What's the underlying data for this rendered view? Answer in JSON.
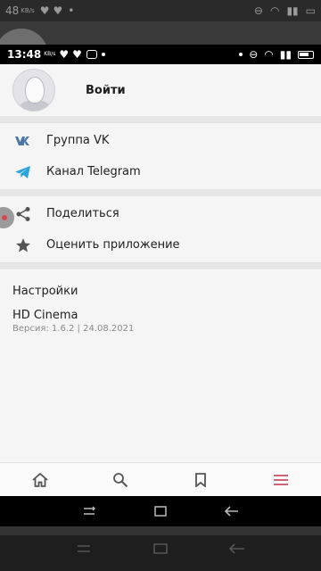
{
  "outer_status": {
    "time": "48",
    "speed_unit": "KB/s"
  },
  "status_bar": {
    "time": "13:48",
    "speed_unit": "KB/s"
  },
  "login": {
    "label": "Войти"
  },
  "menu_group_1": [
    {
      "label": "Группа VK",
      "icon": "vk-icon"
    },
    {
      "label": "Канал Telegram",
      "icon": "telegram-icon"
    }
  ],
  "menu_group_2": [
    {
      "label": "Поделиться",
      "icon": "share-icon"
    },
    {
      "label": "Оценить приложение",
      "icon": "star-icon"
    }
  ],
  "settings": {
    "title": "Настройки",
    "app_name": "HD Cinema",
    "version": "Версия: 1.6.2 | 24.08.2021"
  },
  "bottom_nav": [
    {
      "name": "home",
      "icon": "home-icon"
    },
    {
      "name": "search",
      "icon": "search-icon"
    },
    {
      "name": "bookmarks",
      "icon": "bookmark-icon"
    },
    {
      "name": "menu",
      "icon": "menu-icon",
      "active": true
    }
  ],
  "colors": {
    "vk": "#4a76a8",
    "telegram": "#2aa3df",
    "accent": "#c0304a",
    "icon_gray": "#555555"
  }
}
